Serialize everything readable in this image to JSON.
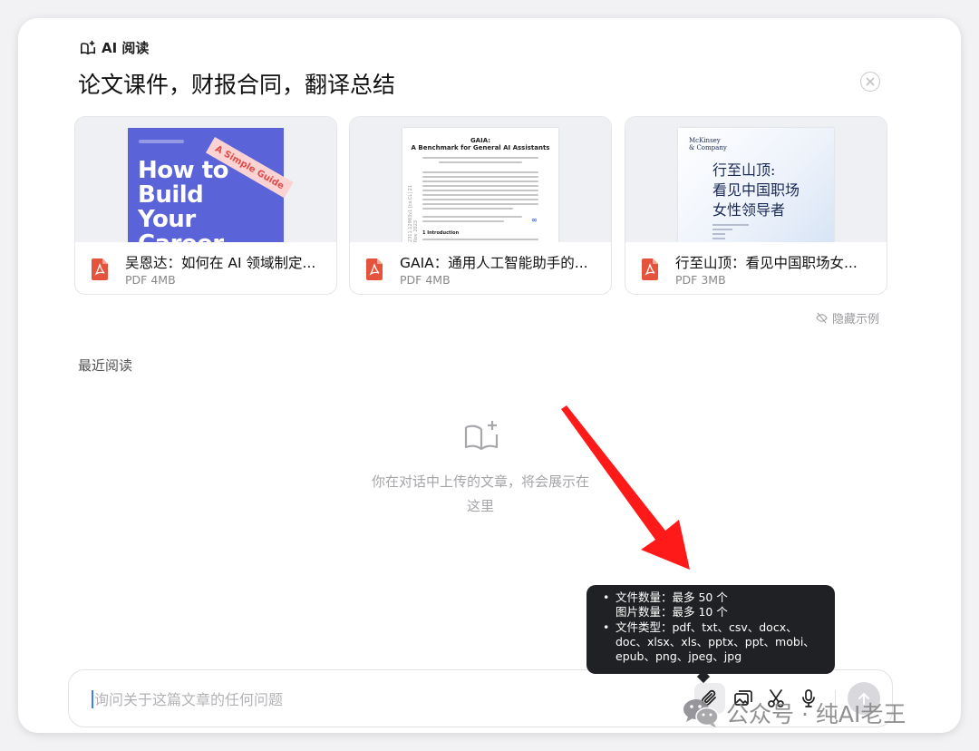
{
  "brand": {
    "label": "AI 阅读"
  },
  "headline": "论文课件，财报合同，翻译总结",
  "examples": [
    {
      "name": "吴恩达：如何在 AI 领域制定...",
      "meta": "PDF 4MB",
      "cover": {
        "ribbon": "A Simple Guide",
        "title": "How to\nBuild\nYour\nCareer"
      }
    },
    {
      "name": "GAIA：通用人工智能助手的...",
      "meta": "PDF 4MB",
      "cover": {
        "title": "GAIA:\nA Benchmark for General AI Assistants",
        "section": "1   Introduction",
        "side": "2311.12983v1 [cs.CL] 21 Nov 2023"
      }
    },
    {
      "name": "行至山顶：看见中国职场女...",
      "meta": "PDF 3MB",
      "cover": {
        "publisher": "McKinsey\n& Company",
        "title": "行至山顶:\n看见中国职场\n女性领导者"
      }
    }
  ],
  "hide_examples": "隐藏示例",
  "recent": {
    "title": "最近阅读",
    "empty_text": "你在对话中上传的文章，将会展示在这里"
  },
  "input": {
    "placeholder": "询问关于这篇文章的任何问题"
  },
  "tooltip": {
    "line1": "文件数量：最多 50 个",
    "line2": "图片数量：最多 10 个",
    "line3": "文件类型：pdf、txt、csv、docx、",
    "line4": "doc、xlsx、xls、pptx、ppt、mobi、",
    "line5": "epub、png、jpeg、jpg"
  },
  "watermark": "公众号 · 纯AI老王",
  "colors": {
    "accent": "#3b7cff",
    "pdf": "#e5533d",
    "arrow": "#ff1a1a",
    "tooltip_bg": "#202124"
  }
}
